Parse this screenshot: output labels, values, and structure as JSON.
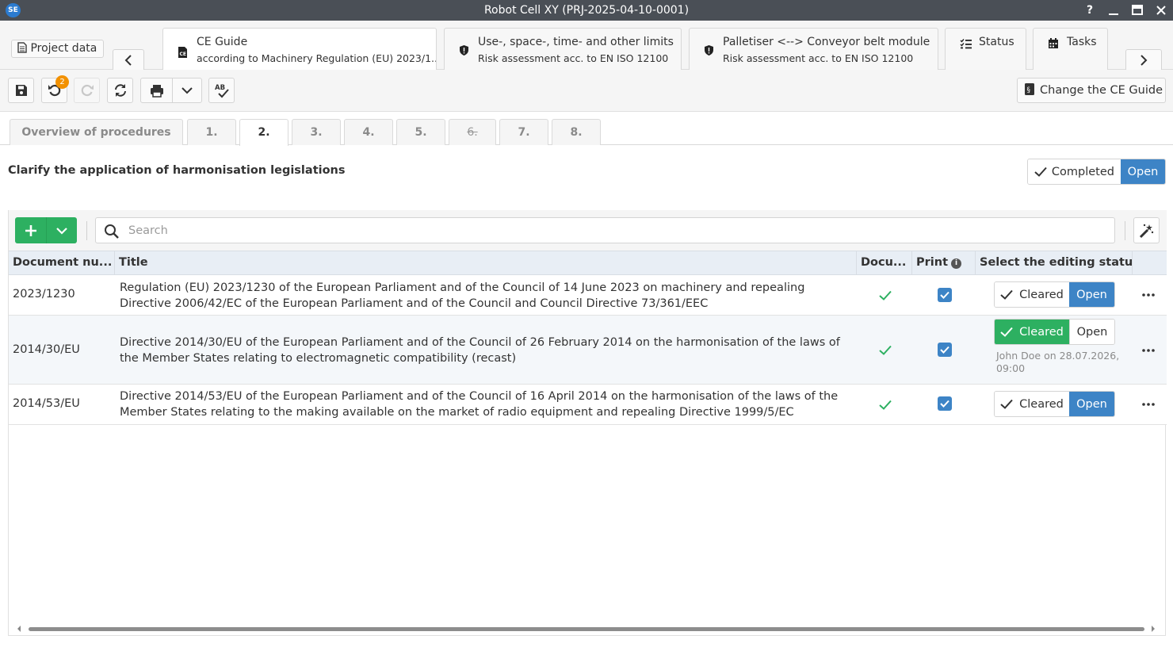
{
  "app": {
    "logo_text": "SE",
    "window_title": "Robot Cell XY (PRJ-2025-04-10-0001)",
    "help_label": "?"
  },
  "tabs": {
    "project_data_label": "Project data",
    "items": [
      {
        "title": "CE Guide",
        "subtitle": "according to Machinery Regulation (EU) 2023/1..."
      },
      {
        "title": "Use-, space-, time- and other limits",
        "subtitle": "Risk assessment acc. to EN ISO 12100"
      },
      {
        "title": "Palletiser <--> Conveyor belt module",
        "subtitle": "Risk assessment acc. to EN ISO 12100"
      },
      {
        "title": "Status",
        "subtitle": ""
      },
      {
        "title": "Tasks",
        "subtitle": ""
      }
    ]
  },
  "toolbar": {
    "undo_count": "2",
    "change_guide_label": "Change the CE Guide"
  },
  "steps": [
    {
      "label": "Overview of procedures"
    },
    {
      "label": "1."
    },
    {
      "label": "2."
    },
    {
      "label": "3."
    },
    {
      "label": "4."
    },
    {
      "label": "5."
    },
    {
      "label": "6."
    },
    {
      "label": "7."
    },
    {
      "label": "8."
    }
  ],
  "section": {
    "title": "Clarify the application of harmonisation legislations",
    "completed_label": "Completed",
    "open_label": "Open"
  },
  "grid": {
    "search_placeholder": "Search",
    "columns": {
      "docnum": "Document nu...",
      "title": "Title",
      "docu": "Docu...",
      "print": "Print",
      "status": "Select the editing status"
    },
    "rows": [
      {
        "docnum": "2023/1230",
        "title": "Regulation (EU) 2023/1230 of the European Parliament and of the Council of 14 June 2023 on machinery and repealing Directive 2006/42/EC of the European Parliament and of the Council and Council Directive 73/361/EEC",
        "cleared_label": "Cleared",
        "open_label": "Open",
        "meta": ""
      },
      {
        "docnum": "2014/30/EU",
        "title": "Directive 2014/30/EU of the European Parliament and of the Council of 26 February 2014 on the harmonisation of the laws of the Member States relating to electromagnetic compatibility (recast)",
        "cleared_label": "Cleared",
        "open_label": "Open",
        "meta": "John  Doe on 28.07.2026, 09:00"
      },
      {
        "docnum": "2014/53/EU",
        "title": "Directive 2014/53/EU of the European Parliament and of the Council of 16 April 2014 on the harmonisation of the laws of the Member States relating to the making available on the market of radio equipment and repealing Directive 1999/5/EC",
        "cleared_label": "Cleared",
        "open_label": "Open",
        "meta": ""
      }
    ]
  },
  "colors": {
    "accent_blue": "#3d84c6",
    "accent_green": "#2db061",
    "badge_orange": "#f29100",
    "titlebar": "#4a4f56"
  }
}
